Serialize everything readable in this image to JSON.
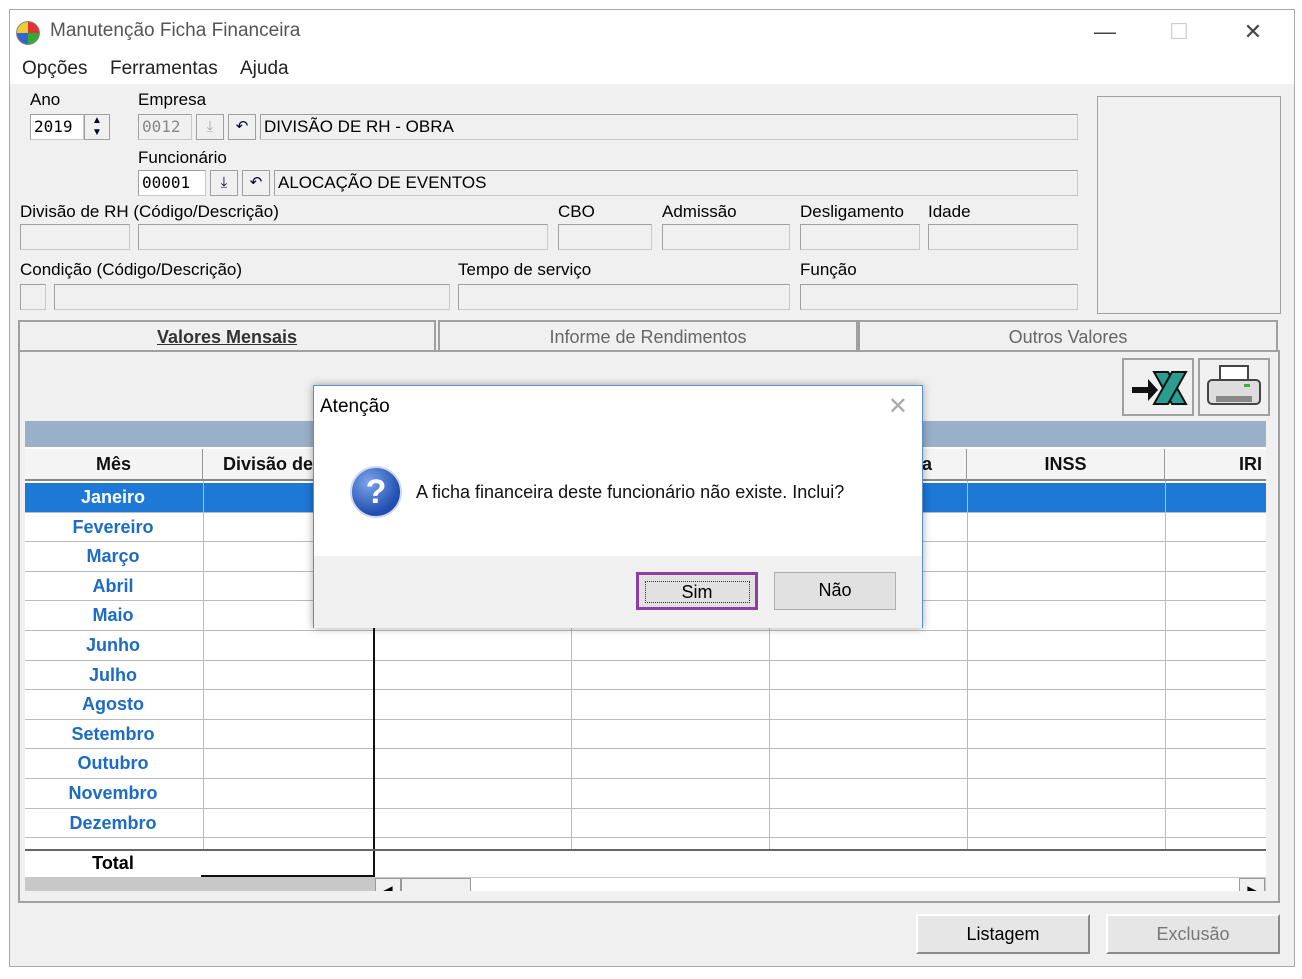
{
  "window": {
    "title": "Manutenção Ficha Financeira",
    "controls": {
      "minimize": "—",
      "maximize": "☐",
      "close": "✕"
    }
  },
  "menu": [
    "Opções",
    "Ferramentas",
    "Ajuda"
  ],
  "header": {
    "ano_label": "Ano",
    "ano_value": "2019",
    "empresa_label": "Empresa",
    "empresa_code": "0012",
    "empresa_desc": "DIVISÃO DE RH - OBRA",
    "funcionario_label": "Funcionário",
    "funcionario_code": "00001",
    "funcionario_desc": "ALOCAÇÃO DE EVENTOS",
    "divisao_label": "Divisão de RH (Código/Descrição)",
    "cbo_label": "CBO",
    "admissao_label": "Admissão",
    "desligamento_label": "Desligamento",
    "idade_label": "Idade",
    "condicao_label": "Condição (Código/Descrição)",
    "tempo_label": "Tempo de serviço",
    "funcao_label": "Função"
  },
  "tabs": [
    {
      "label": "Valores Mensais",
      "active": true
    },
    {
      "label": "Informe de Rendimentos",
      "active": false
    },
    {
      "label": "Outros Valores",
      "active": false
    }
  ],
  "grid": {
    "columns": [
      "Mês",
      "Divisão de",
      "",
      "",
      "a",
      "INSS",
      "IRI"
    ],
    "months": [
      "Janeiro",
      "Fevereiro",
      "Março",
      "Abril",
      "Maio",
      "Junho",
      "Julho",
      "Agosto",
      "Setembro",
      "Outubro",
      "Novembro",
      "Dezembro"
    ],
    "total_label": "Total",
    "selected_row": 0
  },
  "buttons": {
    "listagem": "Listagem",
    "exclusao": "Exclusão"
  },
  "dialog": {
    "title": "Atenção",
    "close": "✕",
    "icon": "?",
    "message": "A ficha financeira deste funcionário não existe. Inclui?",
    "yes": "Sim",
    "no": "Não"
  },
  "colors": {
    "selection": "#1e78d6",
    "month_text": "#1c6bc4",
    "default_button_outline": "#8e3fa3"
  }
}
